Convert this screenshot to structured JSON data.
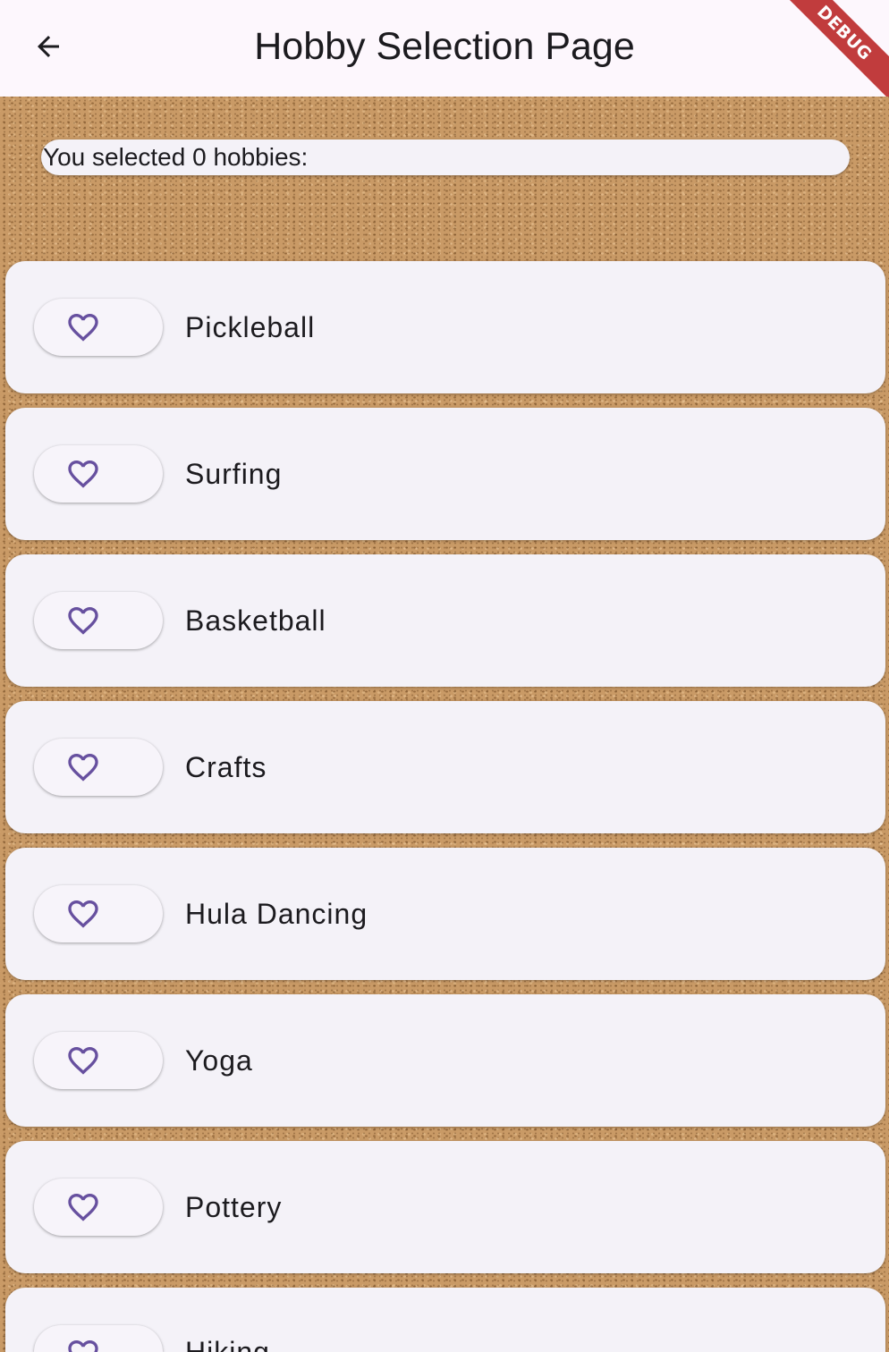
{
  "appbar": {
    "title": "Hobby Selection Page",
    "back_icon": "arrow-back-icon",
    "debug_label": "DEBUG"
  },
  "summary": {
    "text": "You selected 0 hobbies:"
  },
  "hobbies": [
    {
      "label": "Pickleball",
      "icon": "heart-outline-icon"
    },
    {
      "label": "Surfing",
      "icon": "heart-outline-icon"
    },
    {
      "label": "Basketball",
      "icon": "heart-outline-icon"
    },
    {
      "label": "Crafts",
      "icon": "heart-outline-icon"
    },
    {
      "label": "Hula Dancing",
      "icon": "heart-outline-icon"
    },
    {
      "label": "Yoga",
      "icon": "heart-outline-icon"
    },
    {
      "label": "Pottery",
      "icon": "heart-outline-icon"
    },
    {
      "label": "Hiking",
      "icon": "heart-outline-icon"
    }
  ],
  "colors": {
    "accent": "#67509f",
    "appbar_bg": "#fdf7fd",
    "card_bg": "#f4f2f8",
    "debug_banner": "#b71c1c"
  }
}
